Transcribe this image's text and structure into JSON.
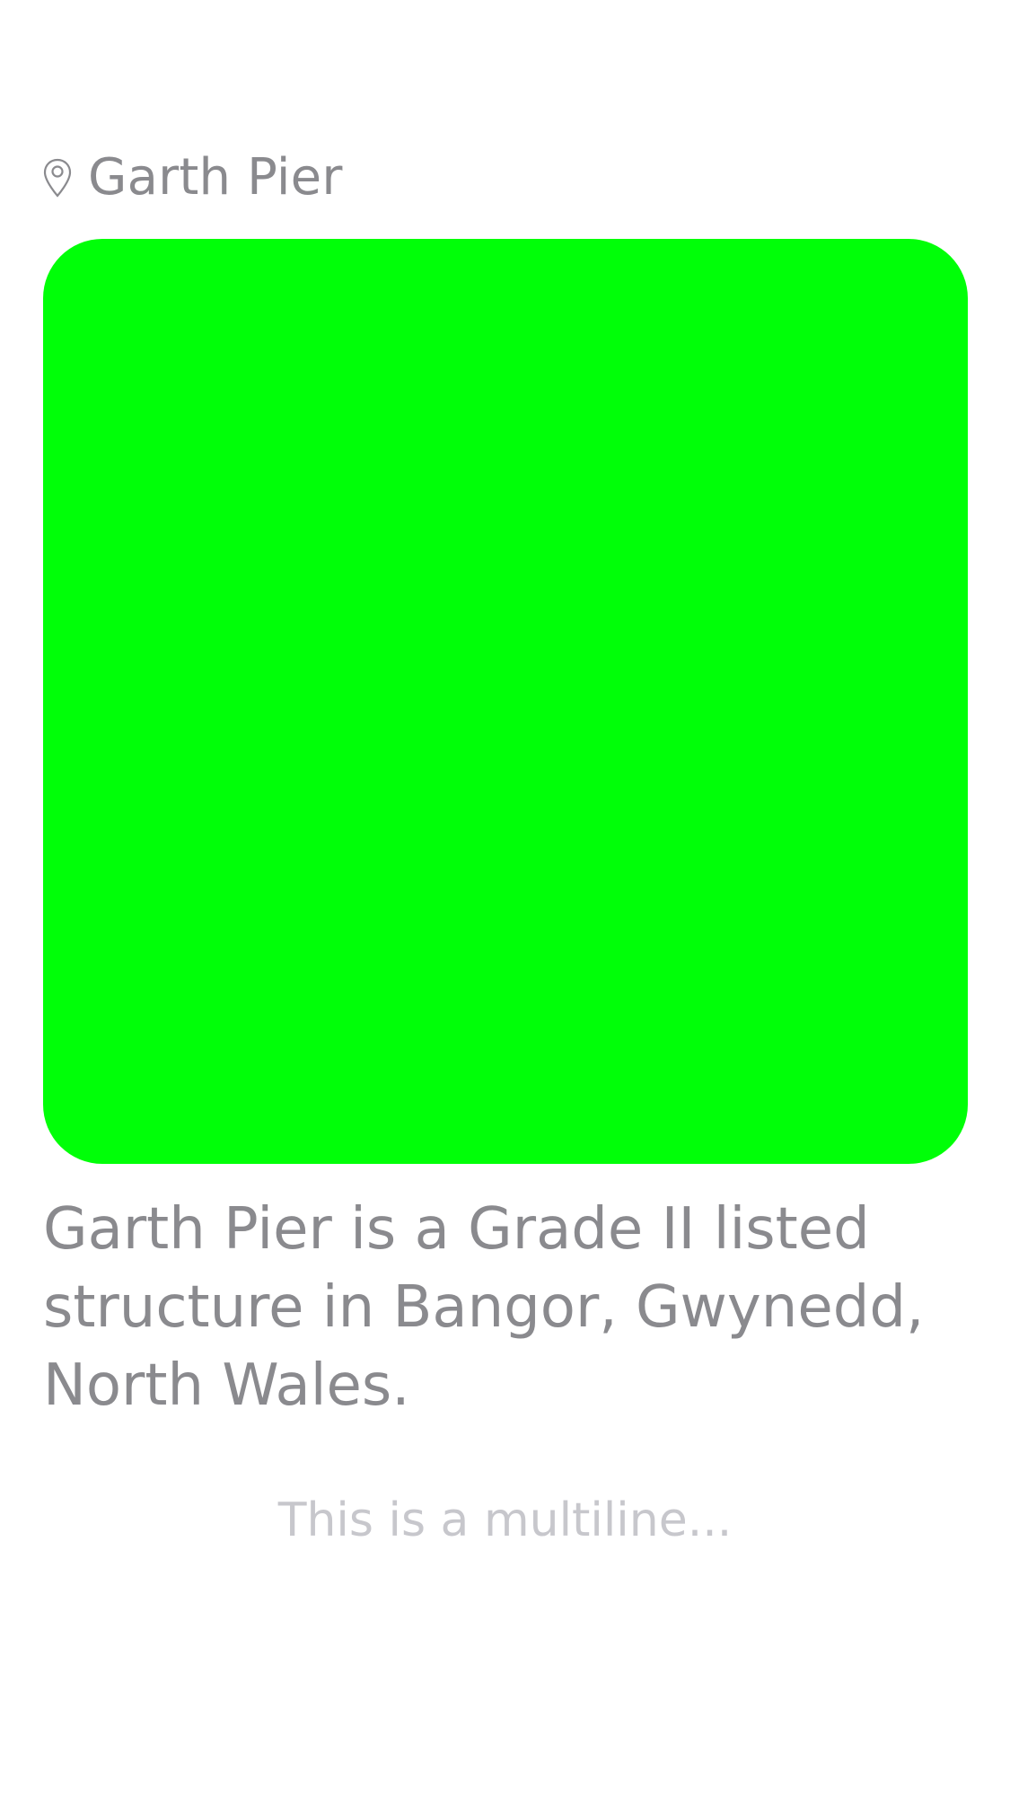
{
  "location": {
    "icon": "location-pin-icon",
    "title": "Garth Pier"
  },
  "media": {
    "color": "#00ff08"
  },
  "description": "Garth Pier is a Grade II listed structure in Bangor, Gwynedd, North Wales.",
  "footer": {
    "text": "This is a multiline..."
  },
  "colors": {
    "secondary_text": "#8a8a8e",
    "tertiary_text": "#c7c7cc",
    "background": "#ffffff"
  }
}
